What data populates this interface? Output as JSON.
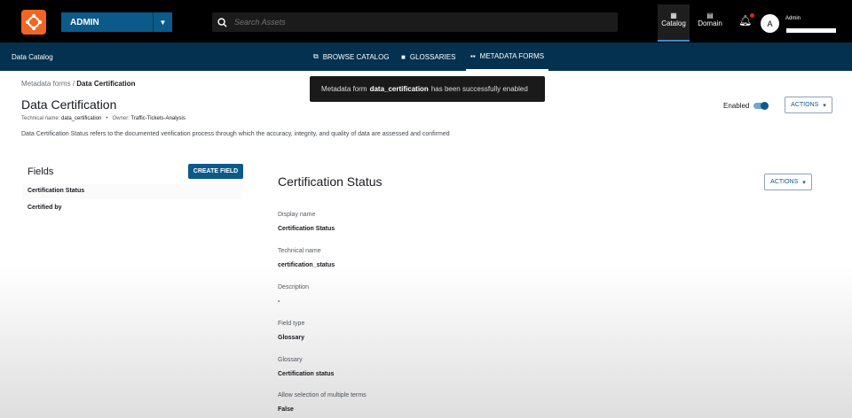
{
  "header": {
    "account": "ADMIN",
    "search_placeholder": "Search Assets",
    "nav": [
      {
        "label": "Catalog"
      },
      {
        "label": "Domain"
      }
    ],
    "avatar_initial": "A",
    "user": "Admin"
  },
  "subnav": {
    "title": "Data Catalog",
    "tabs": [
      {
        "label": "BROWSE CATALOG"
      },
      {
        "label": "GLOSSARIES"
      },
      {
        "label": "METADATA FORMS"
      }
    ]
  },
  "breadcrumb": {
    "parent": "Metadata forms",
    "separator": "/",
    "current": "Data Certification"
  },
  "page": {
    "title": "Data Certification",
    "technical_label": "Technical name:",
    "technical_name": "data_certification",
    "owner_label": "Owner:",
    "owner": "Traffic-Tickets-Analysis",
    "description": "Data Certification Status refers to the documented verification process through which the accuracy, integrity, and quality of data are assessed and confirmed",
    "enabled_label": "Enabled",
    "actions": "ACTIONS"
  },
  "toast": {
    "prefix": "Metadata form ",
    "name": "data_certification",
    "suffix": " has been successfully enabled"
  },
  "fields": {
    "heading": "Fields",
    "create": "CREATE FIELD",
    "items": [
      {
        "label": "Certification Status"
      },
      {
        "label": "Certified by"
      }
    ]
  },
  "detail": {
    "title": "Certification Status",
    "actions": "ACTIONS",
    "rows": [
      {
        "label": "Display name",
        "value": "Certification Status"
      },
      {
        "label": "Technical name",
        "value": "certification_status"
      },
      {
        "label": "Description",
        "value": "-"
      },
      {
        "label": "Field type",
        "value": "Glossary"
      },
      {
        "label": "Glossary",
        "value": "Certification status"
      },
      {
        "label": "Allow selection of multiple terms",
        "value": "False"
      }
    ]
  }
}
